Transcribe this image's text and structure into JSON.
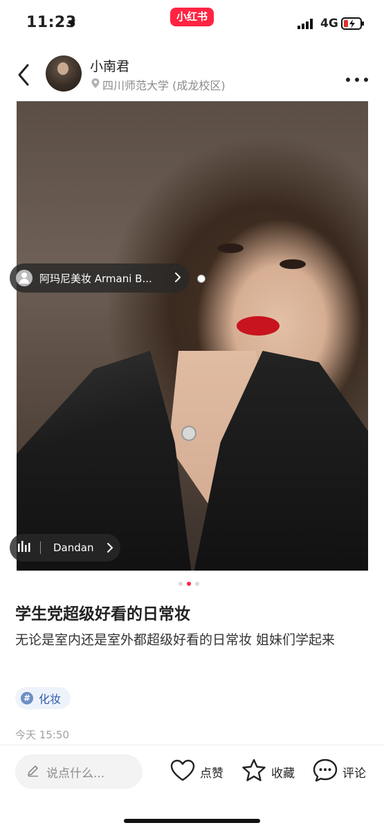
{
  "status_bar": {
    "time": "11:23",
    "brand": "小红书",
    "network": "4G"
  },
  "header": {
    "author_name": "小南君",
    "location": "四川师范大学 (成龙校区)"
  },
  "photo": {
    "product_tag": "阿玛尼美妆 Armani B...",
    "music": "Dandan",
    "page_count": 3,
    "current_page": 2
  },
  "note": {
    "title": "学生党超级好看的日常妆",
    "description": "无论是室内还是室外都超级好看的日常妆 姐妹们学起来",
    "hashtag": "化妆",
    "time": "今天 15:50"
  },
  "bottom_bar": {
    "comment_placeholder": "说点什么...",
    "like_label": "点赞",
    "collect_label": "收藏",
    "comment_label": "评论"
  },
  "colors": {
    "brand": "#ff2442",
    "hashtag": "#2f5ca8"
  }
}
